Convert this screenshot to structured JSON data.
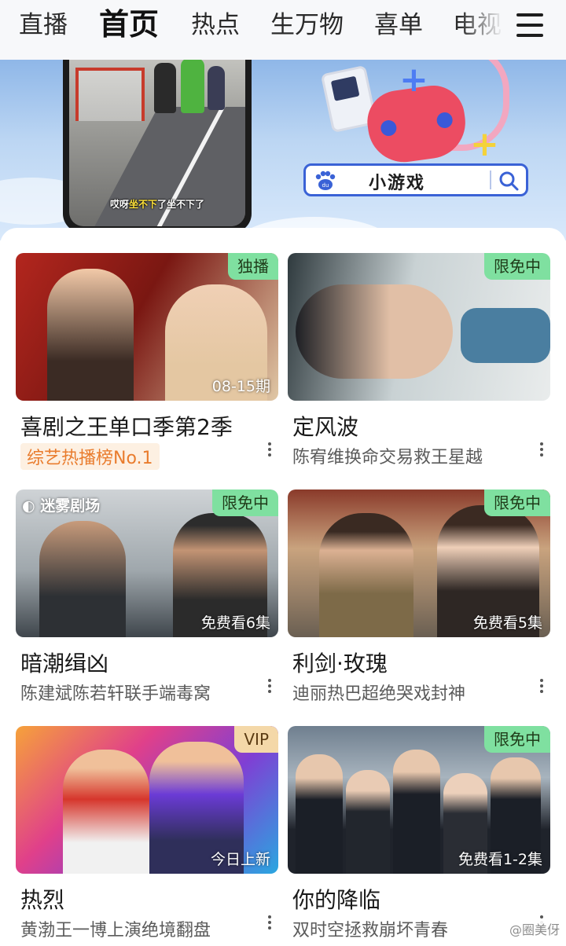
{
  "nav": {
    "tabs": [
      "直播",
      "首页",
      "热点",
      "生万物",
      "喜单",
      "电视"
    ],
    "active_tab": "首页",
    "menu_icon": "hamburger-menu-icon"
  },
  "banner": {
    "game_caption_pre": "哎呀",
    "game_caption_hl": "坐不下",
    "game_caption_post": "了坐不下了",
    "search_label": "小游戏",
    "search_logo": "baidu-paw-icon",
    "search_icon": "search-icon"
  },
  "cards": [
    {
      "title": "喜剧之王单口季第2季",
      "subtitle": "综艺热播榜No.1",
      "subtitle_is_tag": true,
      "badge": "独播",
      "overlay": "08-15期"
    },
    {
      "title": "定风波",
      "subtitle": "陈宥维换命交易救王星越",
      "badge": "限免中",
      "overlay": ""
    },
    {
      "title": "暗潮缉凶",
      "subtitle": "陈建斌陈若轩联手端毒窝",
      "badge": "限免中",
      "overlay": "免费看6集",
      "logo_text": "迷雾剧场"
    },
    {
      "title": "利剑·玫瑰",
      "subtitle": "迪丽热巴超绝哭戏封神",
      "badge": "限免中",
      "overlay": "免费看5集"
    },
    {
      "title": "热烈",
      "subtitle": "黄渤王一博上演绝境翻盘",
      "badge": "VIP",
      "overlay": "今日上新"
    },
    {
      "title": "你的降临",
      "subtitle": "双时空拯救崩坏青春",
      "badge": "限免中",
      "overlay": "免费看1-2集"
    }
  ],
  "watermark": "@圈美伢",
  "colors": {
    "badge_green": "#7fe0a0",
    "badge_vip": "#f4d8a8",
    "tag_orange": "#e97c2d",
    "search_border": "#3a62d6"
  }
}
